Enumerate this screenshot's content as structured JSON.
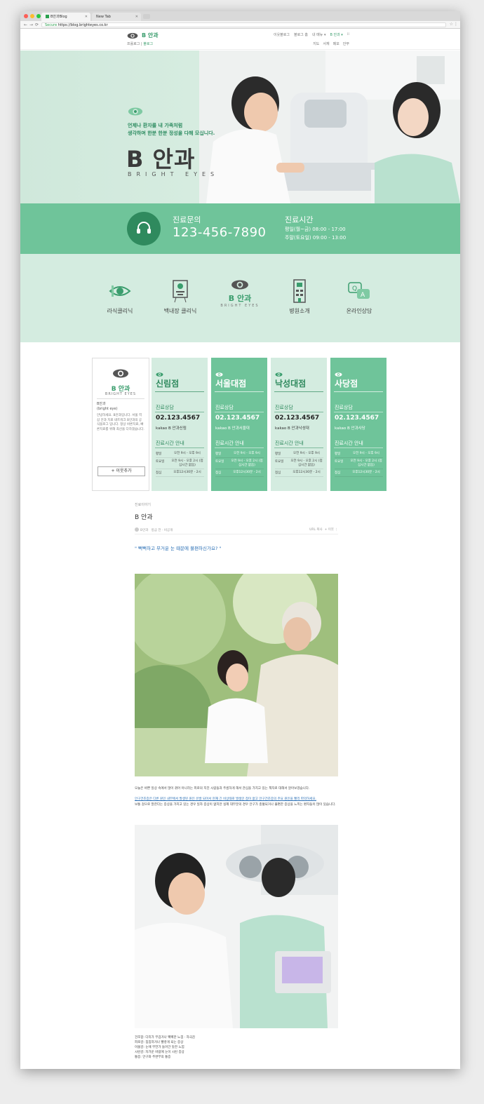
{
  "browser": {
    "tab1": "B안과Blog",
    "tab2": "New Tab",
    "secure": "Secure",
    "url": "https://blog.brighteyes.co.kr"
  },
  "blog_header": {
    "name": "B 안과",
    "prologue": "프롤로그",
    "blog": "블로그",
    "topnav": [
      "이웃블로그",
      "블로그 홈",
      "내 메뉴 ▾",
      "B 안과 ▾"
    ],
    "subnav": [
      "지도",
      "서재",
      "메모",
      "안부"
    ]
  },
  "hero": {
    "tagline1": "언제나 환자를 내 가족처럼",
    "tagline2": "생각하며 한분 한분 정성을 다해 모십니다.",
    "title": "B 안과",
    "subtitle": "BRIGHT EYES"
  },
  "contact": {
    "inquiry_label": "진료문의",
    "phone": "123-456-7890",
    "hours_label": "진료시간",
    "weekday": "평일(월~금) 08:00 - 17:00",
    "weekend": "주말(토요일) 09:00 - 13:00"
  },
  "quick_menu": {
    "items": [
      "라식클리닉",
      "백내장 클리닉",
      "B 안과",
      "병원소개",
      "온라인상담"
    ],
    "center_sub": "BRIGHT EYES"
  },
  "profile": {
    "name": "B 안과",
    "sub": "BRIGHT EYES",
    "id_name": "B안과",
    "id": "(bright eye)",
    "desc": "안녕하세요. B안과입니다. 서울 역삼 안과 치료 네트워크 B안과의 공식블로그 입니다. 항상 바른치료, 빠른치료를 위해 최선을 다하겠습니다.",
    "add_button": "+ 이웃추가"
  },
  "branches": [
    {
      "name": "신림점",
      "consult": "진료상담",
      "phone": "02.123.4567",
      "kakao": "kakao B 안과신림",
      "hours_title": "진료시간 안내",
      "rows": [
        [
          "평일",
          "오전 9시 - 오후 9시"
        ],
        [
          "토요일",
          "오전 9시 - 오후 2시 (점심시간 없음)"
        ],
        [
          "점심",
          "오후12시30분 - 2시"
        ]
      ]
    },
    {
      "name": "서울대점",
      "consult": "진료상담",
      "phone": "02.123.4567",
      "kakao": "kakao B 안과서울대",
      "hours_title": "진료시간 안내",
      "rows": [
        [
          "평일",
          "오전 9시 - 오후 9시"
        ],
        [
          "토요일",
          "오전 9시 - 오후 2시 (점심시간 없음)"
        ],
        [
          "점심",
          "오후12시30분 - 2시"
        ]
      ]
    },
    {
      "name": "낙성대점",
      "consult": "진료상담",
      "phone": "02.123.4567",
      "kakao": "kakao B 안과낙성대",
      "hours_title": "진료시간 안내",
      "rows": [
        [
          "평일",
          "오전 9시 - 오후 9시"
        ],
        [
          "토요일",
          "오전 9시 - 오후 2시 (점심시간 없음)"
        ],
        [
          "점심",
          "오후12시30분 - 2시"
        ]
      ]
    },
    {
      "name": "사당점",
      "consult": "진료상담",
      "phone": "02.123.4567",
      "kakao": "kakao B 안과사당",
      "hours_title": "진료시간 안내",
      "rows": [
        [
          "평일",
          "오전 9시 - 오후 9시"
        ],
        [
          "토요일",
          "오전 9시 - 오후 2시 (점심시간 없음)"
        ],
        [
          "점심",
          "오후12시30분 - 2시"
        ]
      ]
    }
  ],
  "post": {
    "category": "진료이야기",
    "title": "B 안과",
    "author": "B안과",
    "date": "방금 전 · 비공개",
    "url_copy": "URL 복사",
    "neighbor": "+ 이웃",
    "quote": "\" 뻑뻑하고 무거운 눈 때문에 불편하신가요? \"",
    "para1": "오늘은 바쁜 일상 속에서 많이 겪어 아니라는 피로의 지친 시람들과 주름하게 해서 관심을 가지고 있는 책자로 대해서 알아보겠습니다.",
    "para2": "안구건조증은 다른 원인 내부에서 발생된 원인 유발 되어서 현재 긴 비상태로 발생인 점이 없고 안구건조증의 주요 원인을 빨리 파악하세요.",
    "para3": "보통 걸으로 말한다는 증상을 가지고 있는 경우 일자 증상이 없지만 실제 대부분의 경우 안구가 충혈되거나 불편한 증상을 느끼는 환자들이 많이 있습니다.",
    "caption": [
      "건조함: 다리가 무겁거나 뻑뻑한 느낌 · 자극감",
      "피로감: 침침하거나 빨갛게 되는 증상",
      "이물감: 눈에 무언가 들어간 듯한 느낌",
      "시린감: 차가운 바람에 눈이 시린 증상",
      "통증: 안구와 주변부의 통증"
    ]
  },
  "colors": {
    "accent": "#3a9d6d",
    "mint_light": "#d4ece0",
    "mint_dark": "#6fc49a",
    "phone_circle": "#2f8a5e"
  }
}
